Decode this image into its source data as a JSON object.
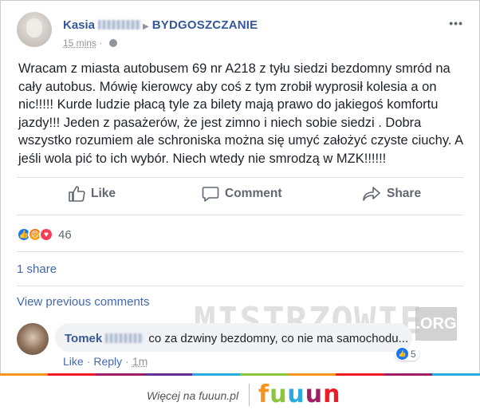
{
  "post": {
    "author": "Kasia",
    "group": "BYDGOSZCZANIE",
    "time": "15 mins",
    "more": "•••",
    "text": "Wracam z miasta autobusem 69 nr A218 z tyłu siedzi bezdomny smród na cały autobus. Mówię kierowcy aby coś z tym zrobił wyprosił kolesia a on nic!!!!! Kurde ludzie płacą tyle za bilety mają prawo do jakiegoś komfortu jazdy!!! Jeden z pasażerów, że jest zimno i niech sobie siedzi . Dobra wszystko rozumiem ale schroniska można się umyć założyć czyste ciuchy. A jeśli wola pić to ich wybór. Niech wtedy nie smrodzą w MZK!!!!!!"
  },
  "actions": {
    "like": "Like",
    "comment": "Comment",
    "share": "Share"
  },
  "reactions": {
    "icons": [
      "like-icon",
      "angry-icon",
      "love-icon"
    ],
    "count": "46"
  },
  "shares": "1 share",
  "view_previous": "View previous comments",
  "comment": {
    "author": "Tomek",
    "text": "co za dzwiny bezdomny, co nie ma samochodu...",
    "like": "Like",
    "reply": "Reply",
    "time": "1m",
    "reaction_count": "5"
  },
  "watermark": {
    "text": "MISTRZOWIE",
    "tld": ".ORG"
  },
  "footer": {
    "text": "Więcej na fuuun.pl",
    "logo_letters": [
      "f",
      "u",
      "u",
      "u",
      "n"
    ],
    "logo_colors": [
      "#f7941d",
      "#8cc63f",
      "#29abe2",
      "#9e1f63",
      "#ed1c24"
    ]
  },
  "stripe_colors": [
    "#f7941d",
    "#ed1c24",
    "#9e1f63",
    "#662d91",
    "#29abe2",
    "#8cc63f",
    "#f7941d",
    "#ed1c24",
    "#9e1f63",
    "#29abe2"
  ],
  "colors": {
    "link": "#365899",
    "muted": "#90949c",
    "text": "#1d2129"
  }
}
